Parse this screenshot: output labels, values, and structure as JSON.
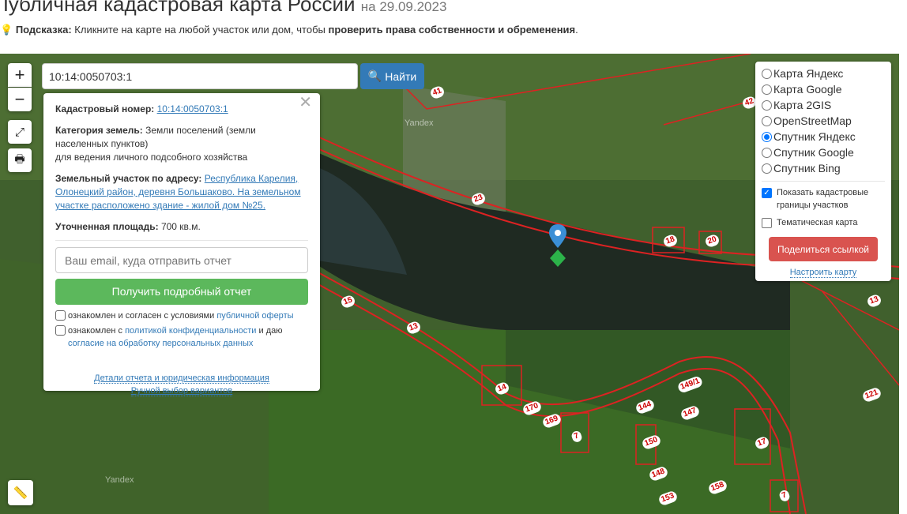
{
  "header": {
    "title": "Публичная кадастровая карта России",
    "date": "на 29.09.2023"
  },
  "hint": {
    "label": "Подсказка:",
    "text": "Кликните на карте на любой участок или дом, чтобы",
    "bold": "проверить права собственности и обременения",
    "end": "."
  },
  "controls": {
    "zoom_in": "+",
    "zoom_out": "−"
  },
  "search": {
    "value": "10:14:0050703:1",
    "button": "Найти"
  },
  "popup": {
    "cad_label": "Кадастровый номер:",
    "cad_value": "10:14:0050703:1",
    "cat_label": "Категория земель:",
    "cat_value": "Земли поселений (земли населенных пунктов)",
    "cat_use": "для ведения личного подсобного хозяйства",
    "addr_label": "Земельный участок по адресу:",
    "addr_value": "Республика Карелия, Олонецкий район, деревня Большаково. На земельном участке расположено здание - жилой дом №25.",
    "area_label": "Уточненная площадь:",
    "area_value": "700 кв.м.",
    "email_placeholder": "Ваш email, куда отправить отчет",
    "report_button": "Получить подробный отчет",
    "agree1_text": "ознакомлен и согласен с условиями",
    "agree1_link": "публичной оферты",
    "agree2_text": "ознакомлен с",
    "agree2_link": "политикой конфиденциальности",
    "agree2_mid": "и даю",
    "agree2_link2": "согласие на обработку персональных данных",
    "details_link": "Детали отчета и юридическая информация",
    "manual_link": "Ручной выбор вариантов"
  },
  "layers": {
    "options": [
      "Карта Яндекс",
      "Карта Google",
      "Карта 2GIS",
      "OpenStreetMap",
      "Спутник Яндекс",
      "Спутник Google",
      "Спутник Bing"
    ],
    "selected": 4,
    "show_borders": "Показать кадастровые границы участков",
    "thematic": "Тематическая карта",
    "share": "Поделиться ссылкой",
    "configure": "Настроить карту"
  },
  "map": {
    "watermark": "Yandex",
    "labels": [
      "41",
      "42",
      "23",
      "18",
      "20",
      "15",
      "13",
      "14",
      "170",
      "169",
      "7",
      "144",
      "149/1",
      "147",
      "150",
      "148",
      "153",
      "158",
      "17",
      "7",
      "121",
      "13"
    ]
  }
}
